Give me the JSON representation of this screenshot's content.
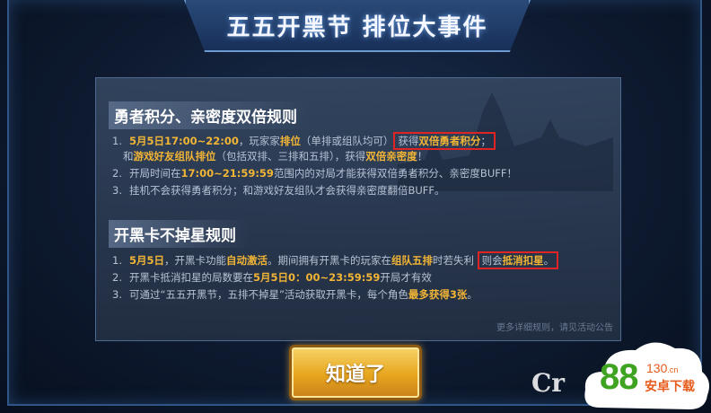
{
  "dialog": {
    "title": "五五开黑节 排位大事件",
    "ok_label": "知道了",
    "footnote": "更多详细规则，请见活动公告"
  },
  "section1": {
    "title": "勇者积分、亲密度双倍规则",
    "rule1": {
      "num": "1.",
      "date": "5月5日17:00~22:00",
      "t1": "，玩家家",
      "ranked": "排位",
      "t2": "（单排或组队均可）",
      "get": "获得",
      "double_points": "双倍勇者积分",
      "t3": "；",
      "l2_a": "和",
      "friend_team": "游戏好友组队排位",
      "l2_b": "（包括双排、三排和五排），获得",
      "double_intimacy": "双倍亲密度",
      "l2_c": "！"
    },
    "rule2": {
      "num": "2.",
      "a": "开局时间在",
      "time": "17:00~21:59:59",
      "b": "范围内的对局才能获得双倍勇者积分、亲密度BUFF！"
    },
    "rule3": {
      "num": "3.",
      "text": "挂机不会获得勇者积分；和游戏好友组队才会获得亲密度翻倍BUFF。"
    }
  },
  "section2": {
    "title": "开黑卡不掉星规则",
    "rule1": {
      "num": "1.",
      "date": "5月5日",
      "a": "，开黑卡功能",
      "auto": "自动激活",
      "b": "。期间拥有开黑卡的玩家在",
      "five": "组队五排",
      "c": "时若失利",
      "then": "则会",
      "offset": "抵消扣星",
      "end": "。"
    },
    "rule2": {
      "num": "2.",
      "a": "开黑卡抵消扣星的局数要在",
      "time": "5月5日0：00~23:59:59",
      "b": "开局才有效"
    },
    "rule3": {
      "num": "3.",
      "a": "可通过“五五开黑节，五排不掉星”活动获取开黑卡，每个角色",
      "most": "最多获得3张",
      "b": "。"
    }
  },
  "watermark": {
    "left_text": "Cr",
    "site_num": "88",
    "site_sup": "130",
    "site_sup_cn": ".cn",
    "site_sub": "安卓下载"
  }
}
